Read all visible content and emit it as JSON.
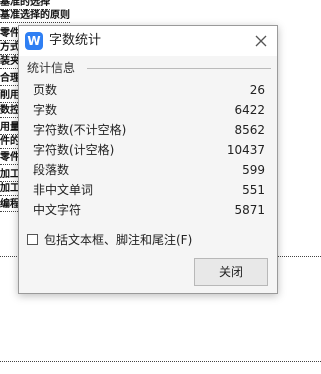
{
  "document": {
    "lines": [
      "基准的选择",
      "基准选择的原则",
      "零件",
      "方式",
      "装夹",
      "合理",
      "削用",
      "数控",
      "用量",
      "件的",
      "零件",
      "加工",
      "加工",
      "编程"
    ]
  },
  "dialog": {
    "app_icon_letter": "W",
    "title": "字数统计",
    "section_label": "统计信息",
    "stats": [
      {
        "label": "页数",
        "value": "26"
      },
      {
        "label": "字数",
        "value": "6422"
      },
      {
        "label": "字符数(不计空格)",
        "value": "8562"
      },
      {
        "label": "字符数(计空格)",
        "value": "10437"
      },
      {
        "label": "段落数",
        "value": "599"
      },
      {
        "label": "非中文单词",
        "value": "551"
      },
      {
        "label": "中文字符",
        "value": "5871"
      }
    ],
    "checkbox_label": "包括文本框、脚注和尾注(F)",
    "close_button_label": "关闭"
  },
  "colors": {
    "app_icon": "#2f7ff3",
    "dialog_bg": "#f5f5f5"
  }
}
